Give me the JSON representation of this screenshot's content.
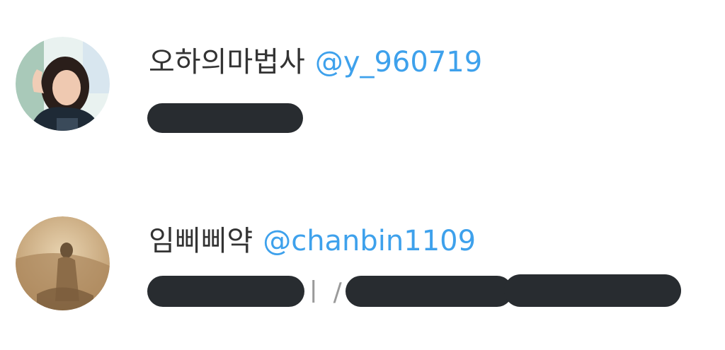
{
  "users": [
    {
      "display_name": "오하의마법사",
      "handle": "@y_960719",
      "avatar_icon": "profile-photo-woman"
    },
    {
      "display_name": "임삐삐약",
      "handle": "@chanbin1109",
      "avatar_icon": "profile-photo-sepia-figure",
      "visible_fragment": "ㅣ /"
    }
  ],
  "colors": {
    "handle": "#3ea1ec",
    "display_name": "#333333",
    "redaction": "#282c30",
    "background": "#ffffff"
  }
}
